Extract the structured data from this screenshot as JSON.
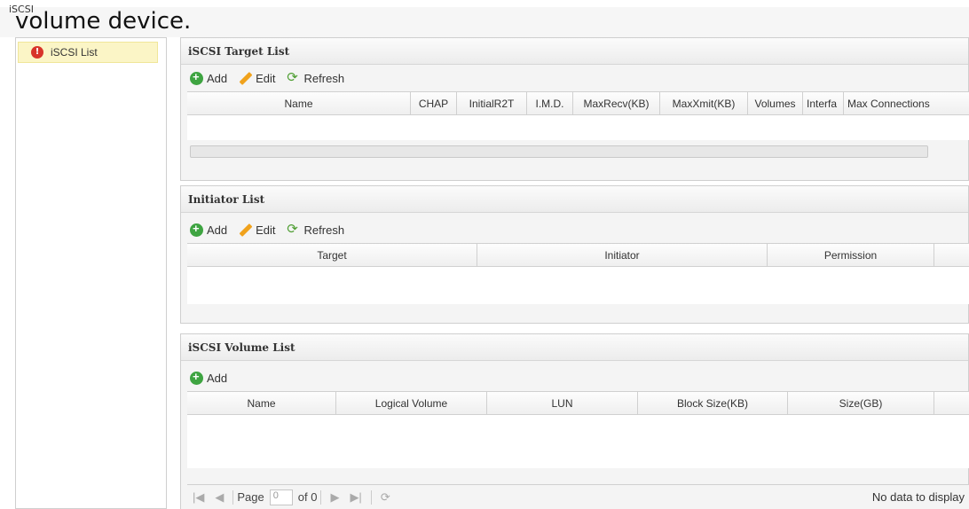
{
  "window": {
    "title": "iSCSI",
    "caption": "volume device."
  },
  "sidebar": {
    "items": [
      {
        "label": "iSCSI List",
        "icon": "iscsi-icon"
      }
    ]
  },
  "target_panel": {
    "title": "iSCSI Target List",
    "toolbar": {
      "add": "Add",
      "edit": "Edit",
      "refresh": "Refresh"
    },
    "columns": [
      "Name",
      "CHAP",
      "InitialR2T",
      "I.M.D.",
      "MaxRecv(KB)",
      "MaxXmit(KB)",
      "Volumes",
      "Interfa",
      "Max Connections"
    ]
  },
  "initiator_panel": {
    "title": "Initiator List",
    "toolbar": {
      "add": "Add",
      "edit": "Edit",
      "refresh": "Refresh"
    },
    "columns": [
      "Target",
      "Initiator",
      "Permission"
    ]
  },
  "volume_panel": {
    "title": "iSCSI Volume List",
    "toolbar": {
      "add": "Add"
    },
    "columns": [
      "Name",
      "Logical Volume",
      "LUN",
      "Block Size(KB)",
      "Size(GB)"
    ],
    "pager": {
      "page_label": "Page",
      "page_value": "0",
      "of_label": "of 0",
      "status": "No data to display"
    }
  },
  "colors": {
    "selected_item_bg": "#fbf5c6",
    "add_icon": "#3ea441",
    "edit_icon": "#f0a21c",
    "refresh_icon": "#4f9e33",
    "iscsi_icon": "#d8342a"
  }
}
